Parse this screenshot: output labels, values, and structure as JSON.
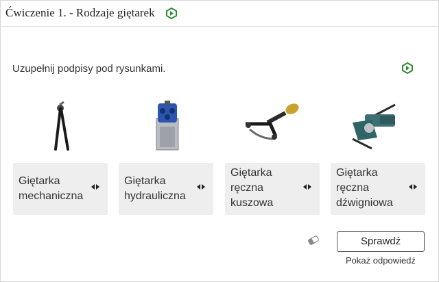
{
  "exercise": {
    "title": "Ćwiczenie 1. - Rodzaje giętarek",
    "instruction": "Uzupełnij podpisy pod rysunkami."
  },
  "cards": [
    {
      "line1": "Giętarka",
      "line2": "mechaniczna",
      "line3": ""
    },
    {
      "line1": "Giętarka",
      "line2": "hydrauliczna",
      "line3": ""
    },
    {
      "line1": "Giętarka",
      "line2": "ręczna",
      "line3": "kuszowa"
    },
    {
      "line1": "Giętarka",
      "line2": "ręczna",
      "line3": "dźwigniowa"
    }
  ],
  "actions": {
    "check_label": "Sprawdź",
    "show_answer_label": "Pokaż odpowiedź"
  },
  "icons": {
    "exercise_icon": "green-hexagon-play-icon",
    "reset_icon": "eraser-icon",
    "reorder_icon": "left-right-arrows-icon"
  },
  "colors": {
    "accent_green": "#2e8b2e",
    "card_bg": "#eeeeee"
  }
}
